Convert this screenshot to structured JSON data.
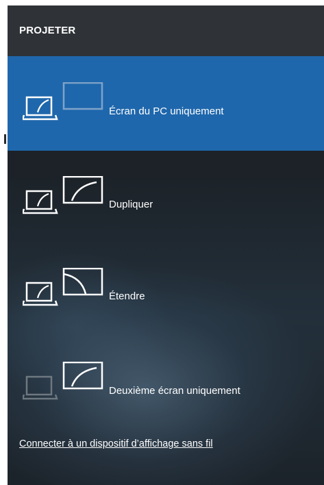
{
  "panel": {
    "title": "PROJETER"
  },
  "options": [
    {
      "label": "Écran du PC uniquement",
      "icon": "pc-screen-only-icon",
      "selected": true
    },
    {
      "label": "Dupliquer",
      "icon": "duplicate-icon",
      "selected": false
    },
    {
      "label": "Étendre",
      "icon": "extend-icon",
      "selected": false
    },
    {
      "label": "Deuxième écran uniquement",
      "icon": "second-screen-only-icon",
      "selected": false
    }
  ],
  "footer": {
    "link_label": "Connecter à un dispositif d’affichage sans fil"
  },
  "colors": {
    "accent": "#1f67ac",
    "header": "#2f3337"
  }
}
